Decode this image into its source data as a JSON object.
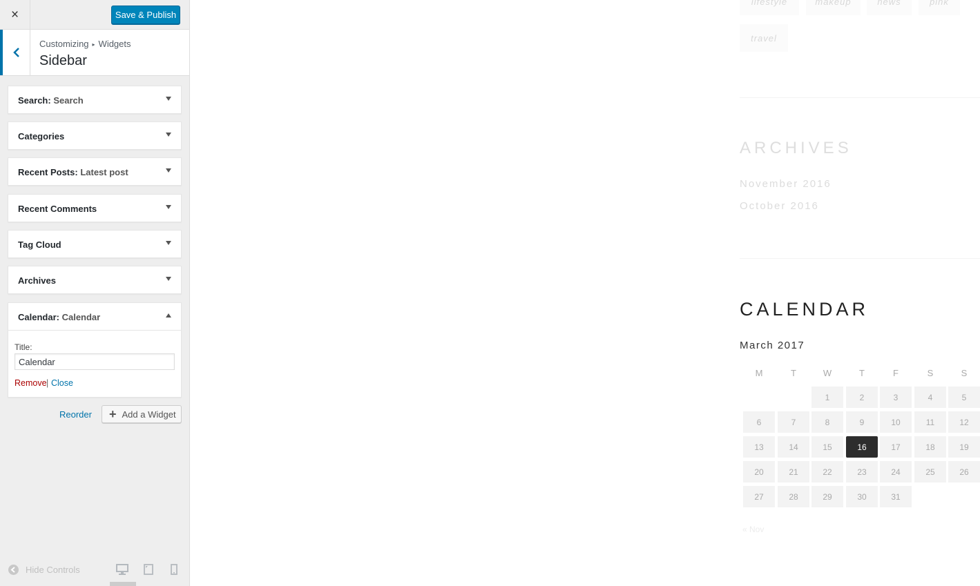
{
  "topbar": {
    "close_icon": "×",
    "publish_label": "Save & Publish",
    "publish_color": "#0085ba"
  },
  "section": {
    "breadcrumb": [
      "Customizing",
      "Widgets"
    ],
    "breadcrumb_sep": "▸",
    "title": "Sidebar"
  },
  "widgets": [
    {
      "name": "Search",
      "sub": "Search",
      "expanded": false
    },
    {
      "name": "Categories",
      "sub": "",
      "expanded": false
    },
    {
      "name": "Recent Posts",
      "sub": "Latest post",
      "expanded": false
    },
    {
      "name": "Recent Comments",
      "sub": "",
      "expanded": false
    },
    {
      "name": "Tag Cloud",
      "sub": "",
      "expanded": false
    },
    {
      "name": "Archives",
      "sub": "",
      "expanded": false
    },
    {
      "name": "Calendar",
      "sub": "Calendar",
      "expanded": true
    }
  ],
  "calendar_form": {
    "title_label": "Title:",
    "title_value": "Calendar",
    "remove_label": "Remove",
    "separator": "|",
    "close_label": "Close"
  },
  "actions": {
    "reorder_label": "Reorder",
    "add_widget_label": "Add a Widget"
  },
  "footer": {
    "hide_controls_label": "Hide Controls",
    "devices": [
      "desktop",
      "tablet",
      "mobile"
    ],
    "active_device": "desktop"
  },
  "preview": {
    "tags_row1": [
      "lifestyle",
      "makeup",
      "news",
      "pink"
    ],
    "tags_row2": [
      "travel"
    ],
    "archives_heading": "ARCHIVES",
    "archives": [
      "November 2016",
      "October 2016"
    ],
    "calendar_heading": "CALENDAR",
    "calendar_month": "March 2017",
    "weekdays": [
      "M",
      "T",
      "W",
      "T",
      "F",
      "S",
      "S"
    ],
    "weeks": [
      [
        "",
        "",
        "1",
        "2",
        "3",
        "4",
        "5"
      ],
      [
        "6",
        "7",
        "8",
        "9",
        "10",
        "11",
        "12"
      ],
      [
        "13",
        "14",
        "15",
        "16",
        "17",
        "18",
        "19"
      ],
      [
        "20",
        "21",
        "22",
        "23",
        "24",
        "25",
        "26"
      ],
      [
        "27",
        "28",
        "29",
        "30",
        "31",
        "",
        ""
      ]
    ],
    "today": "16",
    "prev_link": "« Nov"
  }
}
